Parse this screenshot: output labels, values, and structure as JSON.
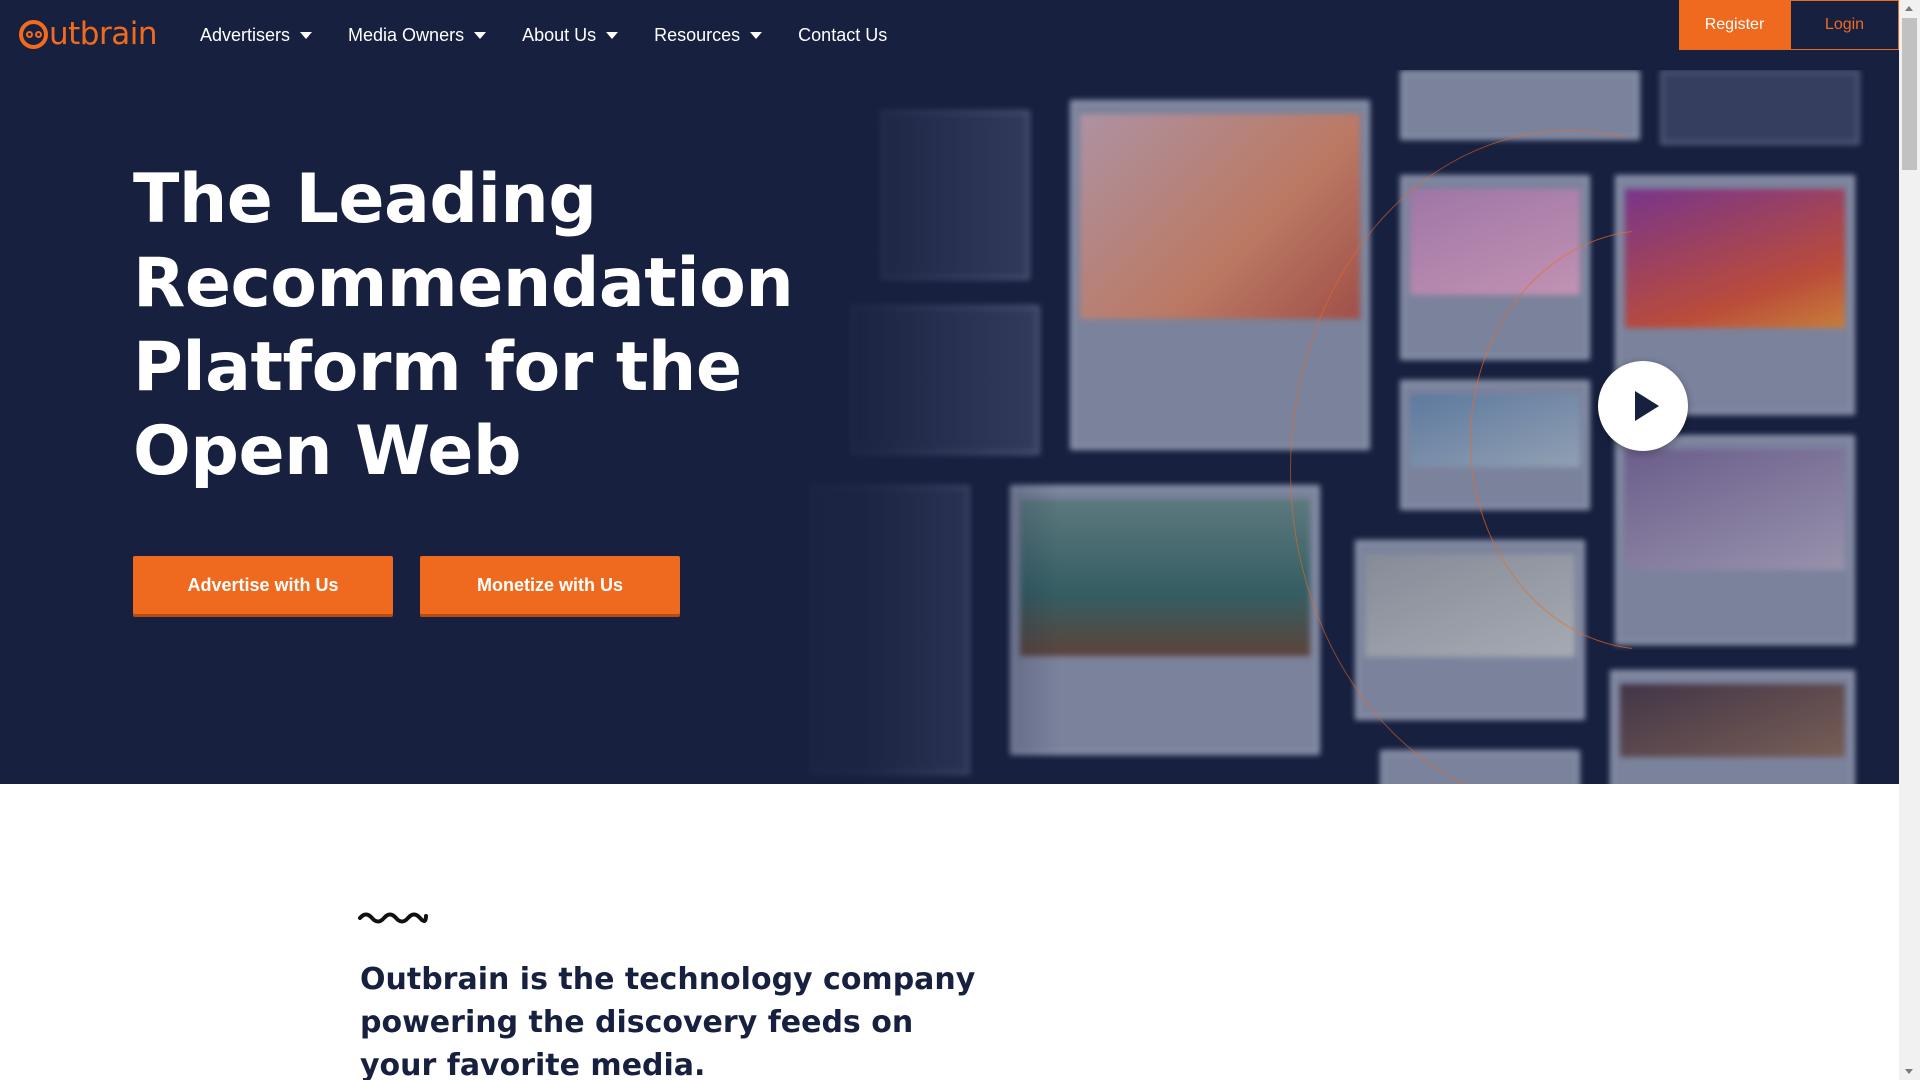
{
  "brand": {
    "name": "outbrain",
    "accent_color": "#ef6a1e",
    "navy_color": "#17203f"
  },
  "nav": {
    "items": [
      {
        "label": "Advertisers",
        "has_dropdown": true
      },
      {
        "label": "Media Owners",
        "has_dropdown": true
      },
      {
        "label": "About Us",
        "has_dropdown": true
      },
      {
        "label": "Resources",
        "has_dropdown": true
      },
      {
        "label": "Contact Us",
        "has_dropdown": false
      }
    ],
    "register_label": "Register",
    "login_label": "Login"
  },
  "hero": {
    "title": "The Leading Recommendation Platform for the Open Web",
    "advertise_label": "Advertise with Us",
    "monetize_label": "Monetize with Us",
    "play_icon": "play-icon"
  },
  "intro": {
    "tagline": "Outbrain is the technology company powering the discovery feeds on your favorite media."
  }
}
